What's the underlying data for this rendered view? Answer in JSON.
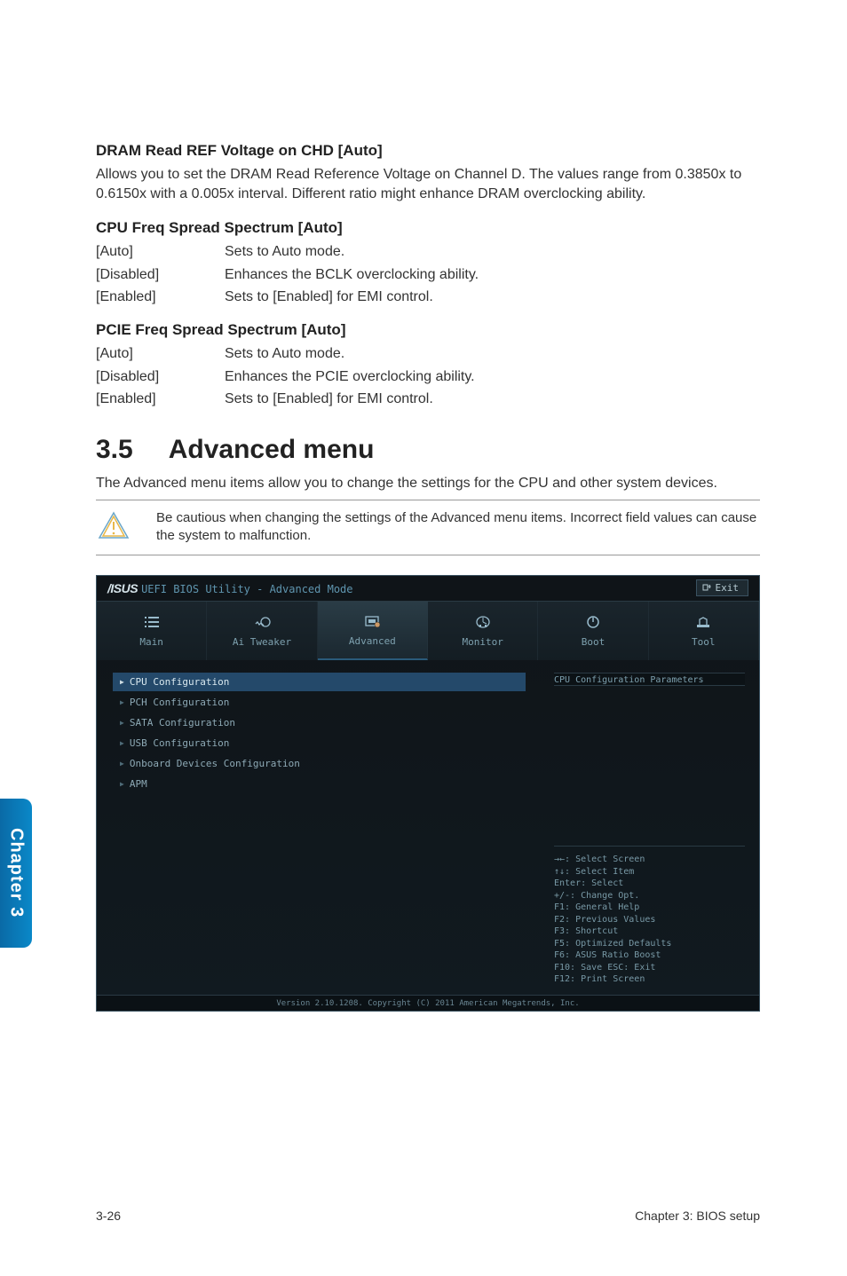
{
  "sideTab": "Chapter 3",
  "sections": {
    "dram": {
      "title": "DRAM Read REF Voltage on CHD [Auto]",
      "para": "Allows you to set the DRAM Read Reference Voltage on Channel D. The values range from 0.3850x to 0.6150x with a 0.005x interval. Different ratio might enhance DRAM overclocking ability."
    },
    "cpuFreq": {
      "title": "CPU Freq Spread Spectrum [Auto]",
      "opts": [
        {
          "k": "[Auto]",
          "v": "Sets to Auto mode."
        },
        {
          "k": "[Disabled]",
          "v": "Enhances the BCLK overclocking ability."
        },
        {
          "k": "[Enabled]",
          "v": "Sets to [Enabled] for EMI control."
        }
      ]
    },
    "pcieFreq": {
      "title": "PCIE Freq Spread Spectrum [Auto]",
      "opts": [
        {
          "k": "[Auto]",
          "v": "Sets to Auto mode."
        },
        {
          "k": "[Disabled]",
          "v": "Enhances the PCIE overclocking ability."
        },
        {
          "k": "[Enabled]",
          "v": "Sets to [Enabled] for EMI control."
        }
      ]
    }
  },
  "advanced": {
    "num": "3.5",
    "title": "Advanced menu",
    "para": "The Advanced menu items allow you to change the settings for the CPU and other system devices.",
    "warn": "Be cautious when changing the settings of the Advanced menu items. Incorrect field values can cause the system to malfunction."
  },
  "bios": {
    "logo": "/ISUS",
    "titleText": "UEFI BIOS Utility - Advanced Mode",
    "exit": "Exit",
    "tabs": [
      {
        "label": "Main"
      },
      {
        "label": "Ai Tweaker"
      },
      {
        "label": "Advanced"
      },
      {
        "label": "Monitor"
      },
      {
        "label": "Boot"
      },
      {
        "label": "Tool"
      }
    ],
    "menu": [
      {
        "label": "CPU Configuration",
        "hl": true
      },
      {
        "label": "PCH Configuration",
        "hl": false
      },
      {
        "label": "SATA Configuration",
        "hl": false
      },
      {
        "label": "USB Configuration",
        "hl": false
      },
      {
        "label": "Onboard Devices Configuration",
        "hl": false
      },
      {
        "label": "APM",
        "hl": false
      }
    ],
    "helpTop": "CPU Configuration Parameters",
    "helpLines": [
      "→←: Select Screen",
      "↑↓: Select Item",
      "Enter: Select",
      "+/-: Change Opt.",
      "F1: General Help",
      "F2: Previous Values",
      "F3: Shortcut",
      "F5: Optimized Defaults",
      "F6: ASUS Ratio Boost",
      "F10: Save  ESC: Exit",
      "F12: Print Screen"
    ],
    "footer": "Version 2.10.1208. Copyright (C) 2011 American Megatrends, Inc."
  },
  "footer": {
    "left": "3-26",
    "right": "Chapter 3: BIOS setup"
  }
}
